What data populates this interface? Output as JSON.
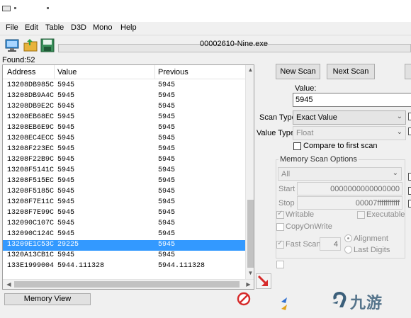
{
  "menu": [
    "File",
    "Edit",
    "Table",
    "D3D",
    "Mono",
    "Help"
  ],
  "process_title": "00002610-Nine.exe",
  "found": "Found:52",
  "list": {
    "headers": {
      "address": "Address",
      "value": "Value",
      "previous": "Previous"
    },
    "rows": [
      {
        "address": "13208DB985C",
        "value": "5945",
        "previous": "5945"
      },
      {
        "address": "13208DB9A4C",
        "value": "5945",
        "previous": "5945"
      },
      {
        "address": "13208DB9E2C",
        "value": "5945",
        "previous": "5945"
      },
      {
        "address": "13208EB68EC",
        "value": "5945",
        "previous": "5945"
      },
      {
        "address": "13208EB6E9C",
        "value": "5945",
        "previous": "5945"
      },
      {
        "address": "13208EC4ECC",
        "value": "5945",
        "previous": "5945"
      },
      {
        "address": "13208F223EC",
        "value": "5945",
        "previous": "5945"
      },
      {
        "address": "13208F22B9C",
        "value": "5945",
        "previous": "5945"
      },
      {
        "address": "13208F5141C",
        "value": "5945",
        "previous": "5945"
      },
      {
        "address": "13208F515EC",
        "value": "5945",
        "previous": "5945"
      },
      {
        "address": "13208F5185C",
        "value": "5945",
        "previous": "5945"
      },
      {
        "address": "13208F7E11C",
        "value": "5945",
        "previous": "5945"
      },
      {
        "address": "13208F7E99C",
        "value": "5945",
        "previous": "5945"
      },
      {
        "address": "132090C107C",
        "value": "5945",
        "previous": "5945"
      },
      {
        "address": "132090C124C",
        "value": "5945",
        "previous": "5945"
      },
      {
        "address": "13209E1C53C",
        "value": "29225",
        "previous": "5945",
        "selected": true,
        "changed": true
      },
      {
        "address": "1320A13CB1C",
        "value": "5945",
        "previous": "5945"
      },
      {
        "address": "133E1999004",
        "value": "5944.111328",
        "previous": "5944.111328"
      }
    ]
  },
  "buttons": {
    "new_scan": "New Scan",
    "next_scan": "Next Scan",
    "memory_view": "Memory View"
  },
  "value_label": "Value:",
  "value_input": "5945",
  "scan_type": {
    "label": "Scan Type",
    "selected": "Exact Value"
  },
  "value_type": {
    "label": "Value Type",
    "selected": "Float"
  },
  "compare_first": "Compare to first scan",
  "memory_scan": {
    "title": "Memory Scan Options",
    "region": "All",
    "start_label": "Start",
    "start_value": "0000000000000000",
    "stop_label": "Stop",
    "stop_value": "00007fffffffffff",
    "writable": "Writable",
    "executable": "Executable",
    "copy_on_write": "CopyOnWrite",
    "fast_scan": "Fast Scan",
    "fast_scan_value": "4",
    "alignment": "Alignment",
    "last_digits": "Last Digits"
  },
  "watermark": "九游",
  "colors": {
    "selection": "#3399ff",
    "changed_value": "#d40000"
  }
}
